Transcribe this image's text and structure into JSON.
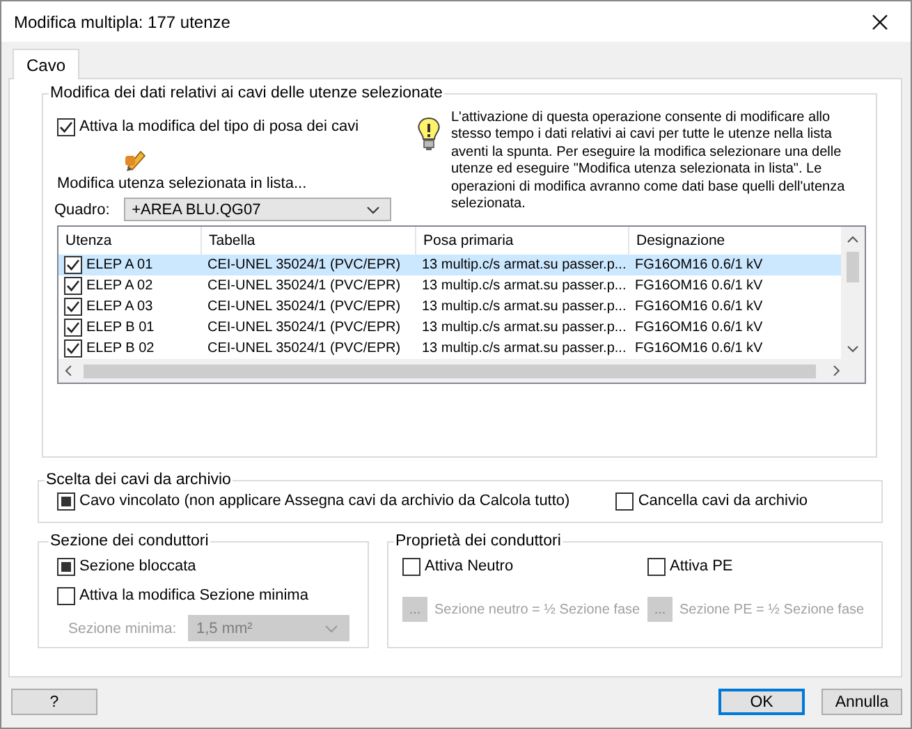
{
  "window": {
    "title": "Modifica multipla: 177 utenze"
  },
  "tabs": [
    {
      "label": "Cavo",
      "selected": true
    }
  ],
  "cable_data_group": {
    "title": "Modifica dei dati relativi ai cavi delle utenze selezionate",
    "options": [
      {
        "label": "Attiva la modifica del tipo di posa dei cavi",
        "checked": true,
        "indeterminate": false
      }
    ],
    "edit_link": "Modifica utenza selezionata in lista...",
    "quadro": {
      "label": "Quadro:",
      "value": "+AREA BLU.QG07"
    },
    "info": "L'attivazione di questa operazione consente di modificare allo stesso tempo i dati relativi ai cavi per tutte le utenze nella lista aventi la spunta. Per eseguire la modifica selezionare una delle utenze ed eseguire \"Modifica utenza selezionata in lista\".  Le operazioni di modifica avranno come dati base quelli dell'utenza selezionata.",
    "table": {
      "columns": [
        "Utenza",
        "Tabella",
        "Posa primaria",
        "Designazione"
      ],
      "rows": [
        {
          "selected": true,
          "checked": true,
          "cells": [
            "ELEP A 01",
            "CEI-UNEL 35024/1 (PVC/EPR)",
            "13 multip.c/s armat.su passer.p...",
            "FG16OM16 0.6/1 kV"
          ]
        },
        {
          "selected": false,
          "checked": true,
          "cells": [
            "ELEP A 02",
            "CEI-UNEL 35024/1 (PVC/EPR)",
            "13 multip.c/s armat.su passer.p...",
            "FG16OM16 0.6/1 kV"
          ]
        },
        {
          "selected": false,
          "checked": true,
          "cells": [
            "ELEP A 03",
            "CEI-UNEL 35024/1 (PVC/EPR)",
            "13 multip.c/s armat.su passer.p...",
            "FG16OM16 0.6/1 kV"
          ]
        },
        {
          "selected": false,
          "checked": true,
          "cells": [
            "ELEP B 01",
            "CEI-UNEL 35024/1 (PVC/EPR)",
            "13 multip.c/s armat.su passer.p...",
            "FG16OM16 0.6/1 kV"
          ]
        },
        {
          "selected": false,
          "checked": true,
          "cells": [
            "ELEP B 02",
            "CEI-UNEL 35024/1 (PVC/EPR)",
            "13 multip.c/s armat.su passer.p...",
            "FG16OM16 0.6/1 kV"
          ]
        }
      ]
    }
  },
  "archive_group": {
    "title": "Scelta dei cavi da archivio",
    "options": [
      {
        "label": "Cavo vincolato (non applicare Assegna cavi da archivio da Calcola tutto)",
        "checked": false,
        "indeterminate": true
      },
      {
        "label": "Cancella cavi da archivio",
        "checked": false,
        "indeterminate": false
      }
    ]
  },
  "section_group": {
    "title": "Sezione dei conduttori",
    "options": [
      {
        "label": "Sezione bloccata",
        "checked": false,
        "indeterminate": true
      },
      {
        "label": "Attiva la modifica Sezione minima",
        "checked": false,
        "indeterminate": false
      }
    ],
    "min_section": {
      "label": "Sezione minima:",
      "value": "1,5 mm²",
      "disabled": true
    }
  },
  "properties_group": {
    "title": "Proprietà dei conduttori",
    "options": [
      {
        "label": "Attiva Neutro",
        "checked": false,
        "indeterminate": false
      },
      {
        "label": "Attiva PE",
        "checked": false,
        "indeterminate": false
      }
    ],
    "actions": [
      {
        "button": "...",
        "label": "Sezione neutro = ½ Sezione fase",
        "disabled": true
      },
      {
        "button": "...",
        "label": "Sezione PE = ½ Sezione fase",
        "disabled": true
      }
    ]
  },
  "buttons": [
    {
      "label": "?",
      "default": false
    },
    {
      "label": "OK",
      "default": true
    },
    {
      "label": "Annulla",
      "default": false
    }
  ]
}
